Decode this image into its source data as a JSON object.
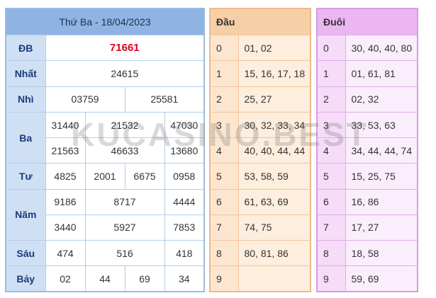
{
  "main": {
    "header": "Thứ Ba - 18/04/2023",
    "prizes": {
      "db": {
        "label": "ĐB",
        "values": [
          "71661"
        ]
      },
      "nhat": {
        "label": "Nhất",
        "values": [
          "24615"
        ]
      },
      "nhi": {
        "label": "Nhì",
        "values": [
          "03759",
          "25581"
        ]
      },
      "ba": {
        "label": "Ba",
        "values": [
          "31440",
          "21532",
          "47030",
          "21563",
          "46633",
          "13680"
        ]
      },
      "tu": {
        "label": "Tư",
        "values": [
          "4825",
          "2001",
          "6675",
          "0958"
        ]
      },
      "nam": {
        "label": "Năm",
        "values": [
          "9186",
          "8717",
          "4444",
          "3440",
          "5927",
          "7853"
        ]
      },
      "sau": {
        "label": "Sáu",
        "values": [
          "474",
          "516",
          "418"
        ]
      },
      "bay": {
        "label": "Bảy",
        "values": [
          "02",
          "44",
          "69",
          "34"
        ]
      }
    }
  },
  "dau": {
    "header": "Đầu",
    "rows": [
      {
        "k": "0",
        "v": "01, 02"
      },
      {
        "k": "1",
        "v": "15, 16, 17, 18"
      },
      {
        "k": "2",
        "v": "25, 27"
      },
      {
        "k": "3",
        "v": "30, 32, 33, 34"
      },
      {
        "k": "4",
        "v": "40, 40, 44, 44"
      },
      {
        "k": "5",
        "v": "53, 58, 59"
      },
      {
        "k": "6",
        "v": "61, 63, 69"
      },
      {
        "k": "7",
        "v": "74, 75"
      },
      {
        "k": "8",
        "v": "80, 81, 86"
      },
      {
        "k": "9",
        "v": ""
      }
    ]
  },
  "duoi": {
    "header": "Đuôi",
    "rows": [
      {
        "k": "0",
        "v": "30, 40, 40, 80"
      },
      {
        "k": "1",
        "v": "01, 61, 81"
      },
      {
        "k": "2",
        "v": "02, 32"
      },
      {
        "k": "3",
        "v": "33, 53, 63"
      },
      {
        "k": "4",
        "v": "34, 44, 44, 74"
      },
      {
        "k": "5",
        "v": "15, 25, 75"
      },
      {
        "k": "6",
        "v": "16, 86"
      },
      {
        "k": "7",
        "v": "17, 27"
      },
      {
        "k": "8",
        "v": "18, 58"
      },
      {
        "k": "9",
        "v": "59, 69"
      }
    ]
  },
  "watermark": "KUCASINO.BEST"
}
